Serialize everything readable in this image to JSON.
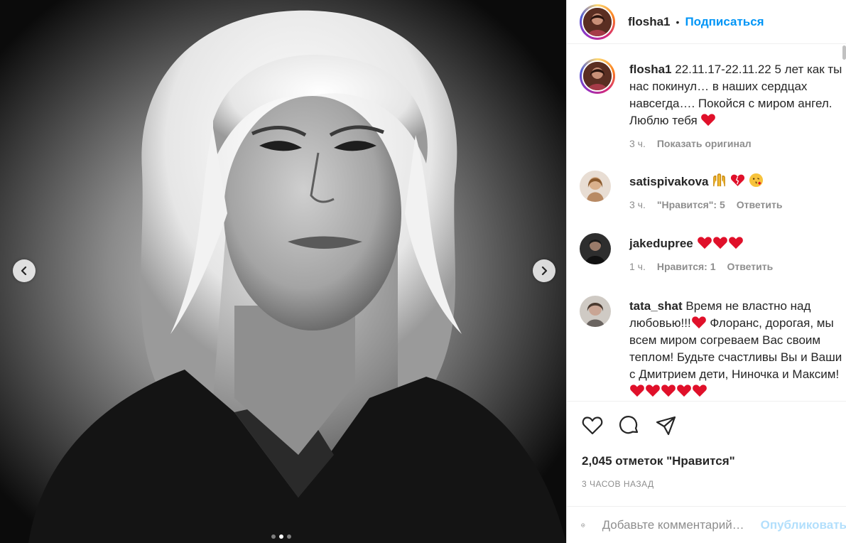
{
  "post": {
    "author": "flosha1",
    "separator": "•",
    "follow_label": "Подписаться",
    "carousel": {
      "slide_count": 3,
      "active_slide": 2
    }
  },
  "caption": {
    "username": "flosha1",
    "text": "22.11.17-22.11.22 5 лет как ты нас покинул… в наших сердцах навсегда…. Покойся с миром ангел. Люблю тебя",
    "emoji": [
      "red-heart"
    ],
    "time": "3 ч.",
    "translate_label": "Показать оригинал"
  },
  "comments": [
    {
      "username": "satispivakova",
      "text": "",
      "emoji": [
        "hands-raised",
        "broken-heart",
        "face-blowing-kiss"
      ],
      "time": "3 ч.",
      "likes_label": "\"Нравится\": 5",
      "reply_label": "Ответить"
    },
    {
      "username": "jakedupree",
      "text": "",
      "emoji": [
        "red-heart",
        "red-heart",
        "red-heart"
      ],
      "time": "1 ч.",
      "likes_label": "Нравится: 1",
      "reply_label": "Ответить"
    },
    {
      "username": "tata_shat",
      "text_part1": "Время не властно над любовью!!!",
      "text_part2": " Флоранс, дорогая, мы всем миром согреваем Вас своим теплом! Будьте счастливы Вы и Ваши с Дмитрием дети, Ниночка и Максим!",
      "emoji": [
        "red-heart",
        "red-heart",
        "red-heart",
        "red-heart",
        "red-heart",
        "red-heart"
      ]
    }
  ],
  "actions": {
    "icons": [
      "heart-icon",
      "comment-icon",
      "share-icon"
    ],
    "likes_text": "2,045 отметок \"Нравится\"",
    "time_ago": "3 ЧАСОВ НАЗАД"
  },
  "add_comment": {
    "placeholder": "Добавьте комментарий…",
    "publish_label": "Опубликовать"
  },
  "colors": {
    "accent": "#0095f6",
    "publish_disabled": "#b2dffc",
    "secondary_text": "#8e8e8e",
    "heart": "#e0102a"
  }
}
